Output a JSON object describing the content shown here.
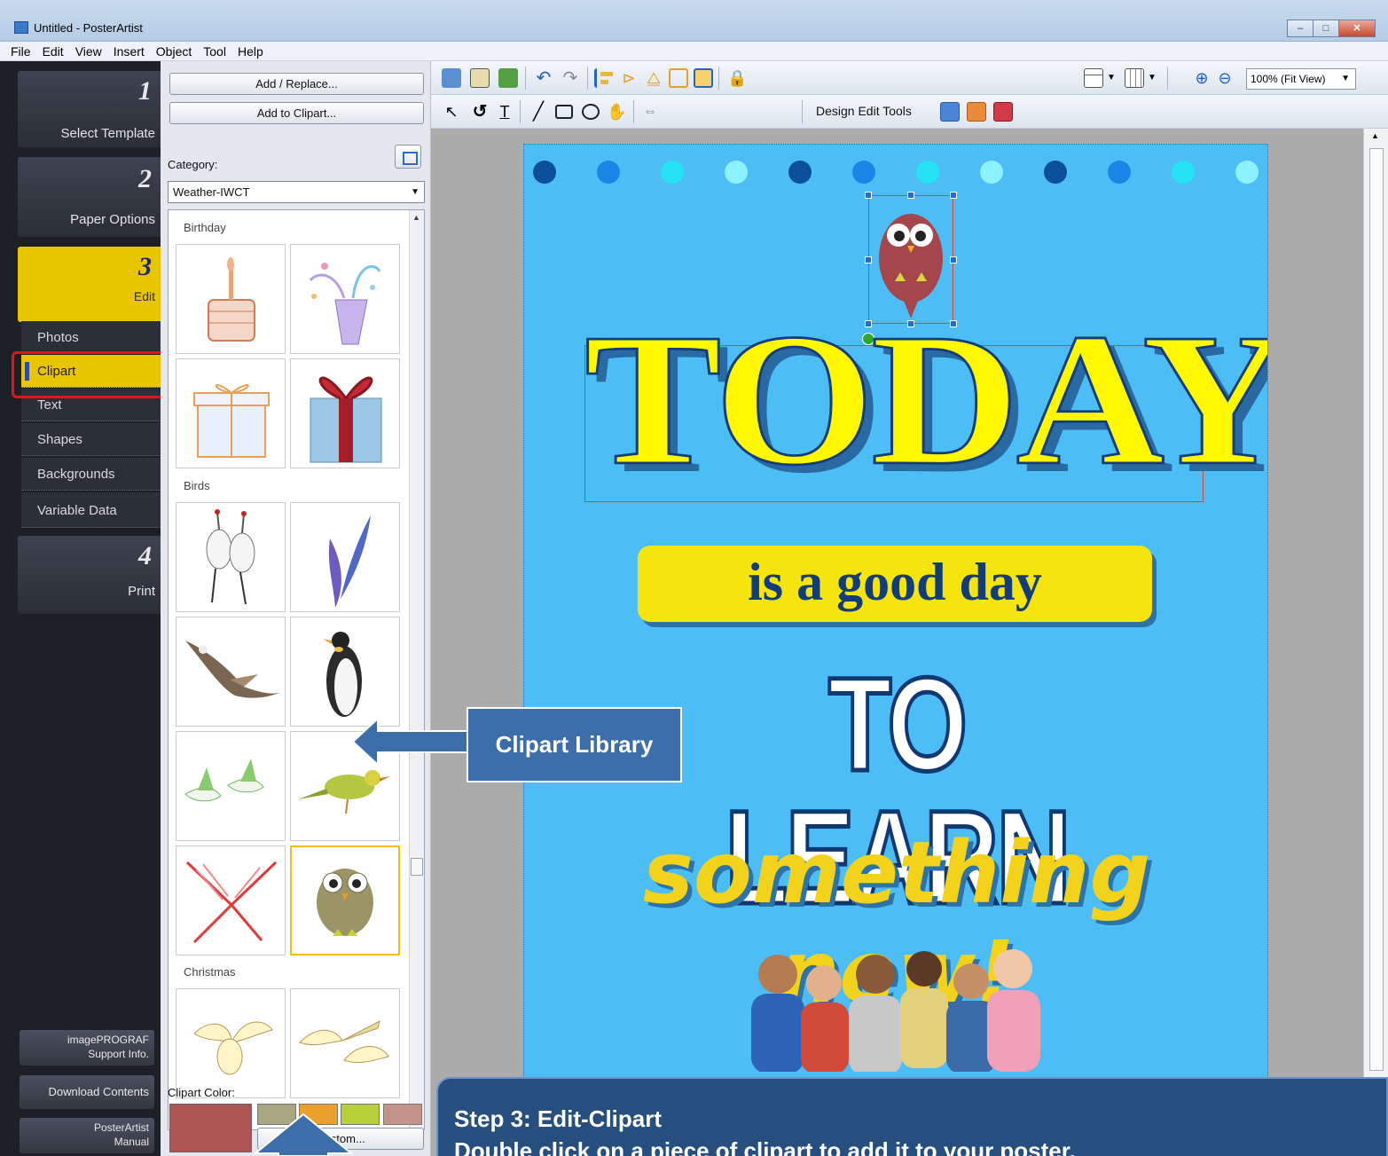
{
  "window": {
    "title": "Untitled - PosterArtist"
  },
  "menu": [
    "File",
    "Edit",
    "View",
    "Insert",
    "Object",
    "Tool",
    "Help"
  ],
  "nav": {
    "steps": [
      {
        "num": "1",
        "label": "Select Template"
      },
      {
        "num": "2",
        "label": "Paper Options"
      },
      {
        "num": "3",
        "label": "Edit"
      },
      {
        "num": "4",
        "label": "Print"
      }
    ],
    "subitems": [
      "Photos",
      "Clipart",
      "Text",
      "Shapes",
      "Backgrounds",
      "Variable Data"
    ],
    "support": "imagePROGRAF\nSupport Info.",
    "download": "Download Contents",
    "manual": "PosterArtist\nManual"
  },
  "panel": {
    "add_replace": "Add / Replace...",
    "add_to_clipart": "Add to Clipart...",
    "category_label": "Category:",
    "category_value": "Weather-IWCT",
    "sections": [
      "Birthday",
      "Birds",
      "Christmas"
    ],
    "clipart_color_label": "Clipart Color:",
    "custom_label": "Custom...",
    "colors": {
      "selected": "#ad5555",
      "swatches": [
        "#a9a781",
        "#e9a12b",
        "#b8d03a",
        "#c4938a"
      ]
    }
  },
  "toolbar": {
    "zoom": "100% (Fit View)",
    "design_tools": "Design Edit Tools"
  },
  "poster": {
    "headline": "TODAY",
    "line2": "is a good day",
    "line3": "TO LEARN",
    "line4": "something new!",
    "dot_colors": [
      "#0c4f9a",
      "#1a86e6",
      "#25e2f5",
      "#8df2ff",
      "#0c4f9a",
      "#1a86e6",
      "#25e2f5",
      "#8df2ff",
      "#0c4f9a",
      "#1a86e6",
      "#25e2f5",
      "#8df2ff"
    ]
  },
  "callouts": {
    "library": "Clipart Library",
    "step_title": "Step 3: Edit-Clipart",
    "step_text": "Double click on a piece of clipart to add it to your poster."
  }
}
